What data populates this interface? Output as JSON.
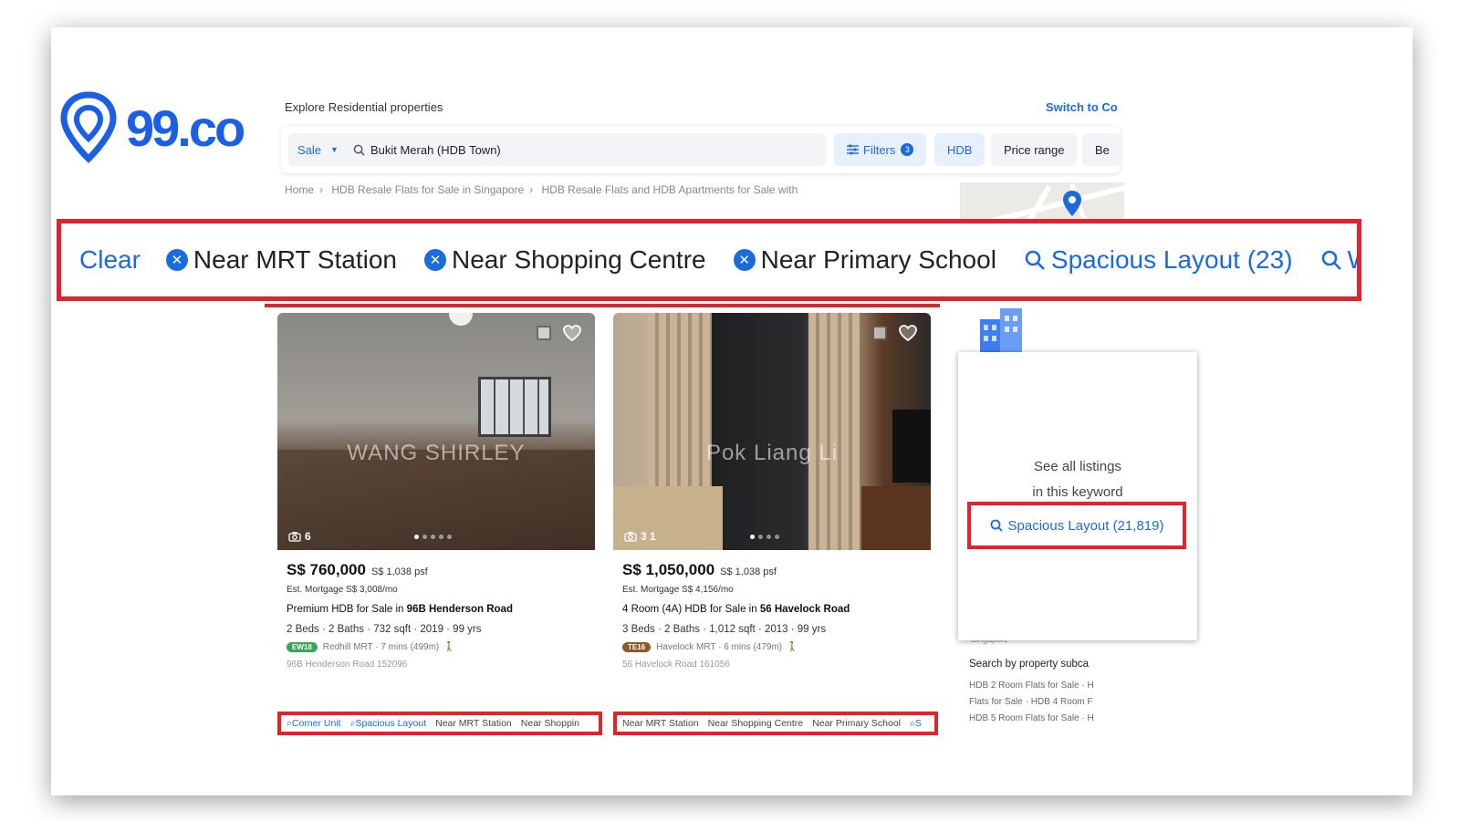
{
  "brand": {
    "logo_text": "99.co",
    "color": "#1a5fe6"
  },
  "header": {
    "explore_label": "Explore Residential properties",
    "switch_label": "Switch to Co"
  },
  "search": {
    "mode": "Sale",
    "location": "Bukit Merah (HDB Town)",
    "filters_label": "Filters",
    "filters_count": "3",
    "hdb_label": "HDB",
    "price_label": "Price range",
    "beds_label": "Be"
  },
  "breadcrumb": [
    "Home",
    "HDB Resale Flats for Sale in Singapore",
    "HDB Resale Flats and HDB Apartments for Sale with"
  ],
  "banner": {
    "clear_label": "Clear",
    "chips": [
      "Near MRT Station",
      "Near Shopping Centre",
      "Near Primary School"
    ],
    "search_chips": [
      "Spacious Layout (23)",
      "We"
    ]
  },
  "listings": [
    {
      "watermark": "WANG SHIRLEY",
      "photo_count": "6",
      "price": "S$ 760,000",
      "psf": "S$ 1,038 psf",
      "mortgage": "Est. Mortgage S$ 3,008/mo",
      "title_prefix": "Premium HDB for Sale in",
      "title_bold": "96B Henderson Road",
      "specs": "2 Beds · 2 Baths · 732 sqft · 2019 · 99 yrs",
      "mrt_code": "EW18",
      "mrt_color": "#3aa655",
      "mrt_text": "Redhill MRT · 7 mins (499m)",
      "address": "96B Henderson Road 152096",
      "search_tags": [
        "Corner Unit",
        "Spacious Layout"
      ],
      "tags": [
        "Near MRT Station",
        "Near Shoppin"
      ]
    },
    {
      "watermark": "Pok Liang Li",
      "photo_count": "3  1",
      "price": "S$ 1,050,000",
      "psf": "S$ 1,038 psf",
      "mortgage": "Est. Mortgage S$ 4,156/mo",
      "title_prefix": "4 Room (4A) HDB for Sale in",
      "title_bold": "56 Havelock Road",
      "specs": "3 Beds · 2 Baths · 1,012 sqft · 2013 · 99 yrs",
      "mrt_code": "TE16",
      "mrt_color": "#8b5a2b",
      "mrt_text": "Havelock MRT · 6 mins (479m)",
      "address": "56 Havelock Road 161056",
      "tags": [
        "Near MRT Station",
        "Near Shopping Centre",
        "Near Primary School"
      ],
      "search_tags": [
        "S"
      ]
    }
  ],
  "popup": {
    "line1": "See all listings",
    "line2": "in this keyword",
    "link": "Spacious Layout (21,819)"
  },
  "sidebar": {
    "sg_label": "Singapore",
    "subcat_title": "Search by property subca",
    "links": [
      "HDB 2 Room Flats for Sale · H",
      "Flats for Sale · HDB 4 Room F",
      "HDB 5 Room Flats for Sale · H"
    ]
  },
  "colors": {
    "accent": "#1a6bdc",
    "highlight": "#e3232c"
  }
}
